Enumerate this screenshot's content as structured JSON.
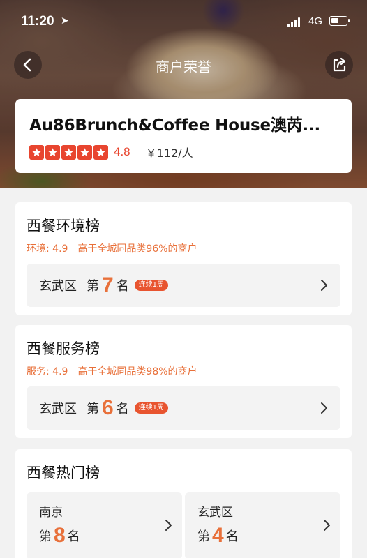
{
  "status": {
    "time": "11:20",
    "network": "4G"
  },
  "nav": {
    "title": "商户荣誉"
  },
  "merchant": {
    "name": "Au86Brunch&Coffee House澳芮...",
    "rating": "4.8",
    "stars": 5,
    "price": "￥112/人"
  },
  "colors": {
    "accent": "#e8703a",
    "star": "#e8452f",
    "badge": "#e8542f"
  },
  "rankings": [
    {
      "title": "西餐环境榜",
      "label": "环境: 4.9",
      "compare": "高于全城同品类96%的商户",
      "district": "玄武区",
      "di": "第",
      "rank": "7",
      "ming": "名",
      "badge": "连续1周"
    },
    {
      "title": "西餐服务榜",
      "label": "服务: 4.9",
      "compare": "高于全城同品类98%的商户",
      "district": "玄武区",
      "di": "第",
      "rank": "6",
      "ming": "名",
      "badge": "连续1周"
    }
  ],
  "hot": {
    "title": "西餐热门榜",
    "items": [
      {
        "area": "南京",
        "di": "第",
        "rank": "8",
        "ming": "名"
      },
      {
        "area": "玄武区",
        "di": "第",
        "rank": "4",
        "ming": "名"
      }
    ]
  },
  "icons": {
    "back": "chevron-left-icon",
    "share": "share-icon",
    "arrow": "chevron-right-icon",
    "location": "location-arrow-icon",
    "signal": "signal-icon",
    "battery": "battery-icon"
  }
}
